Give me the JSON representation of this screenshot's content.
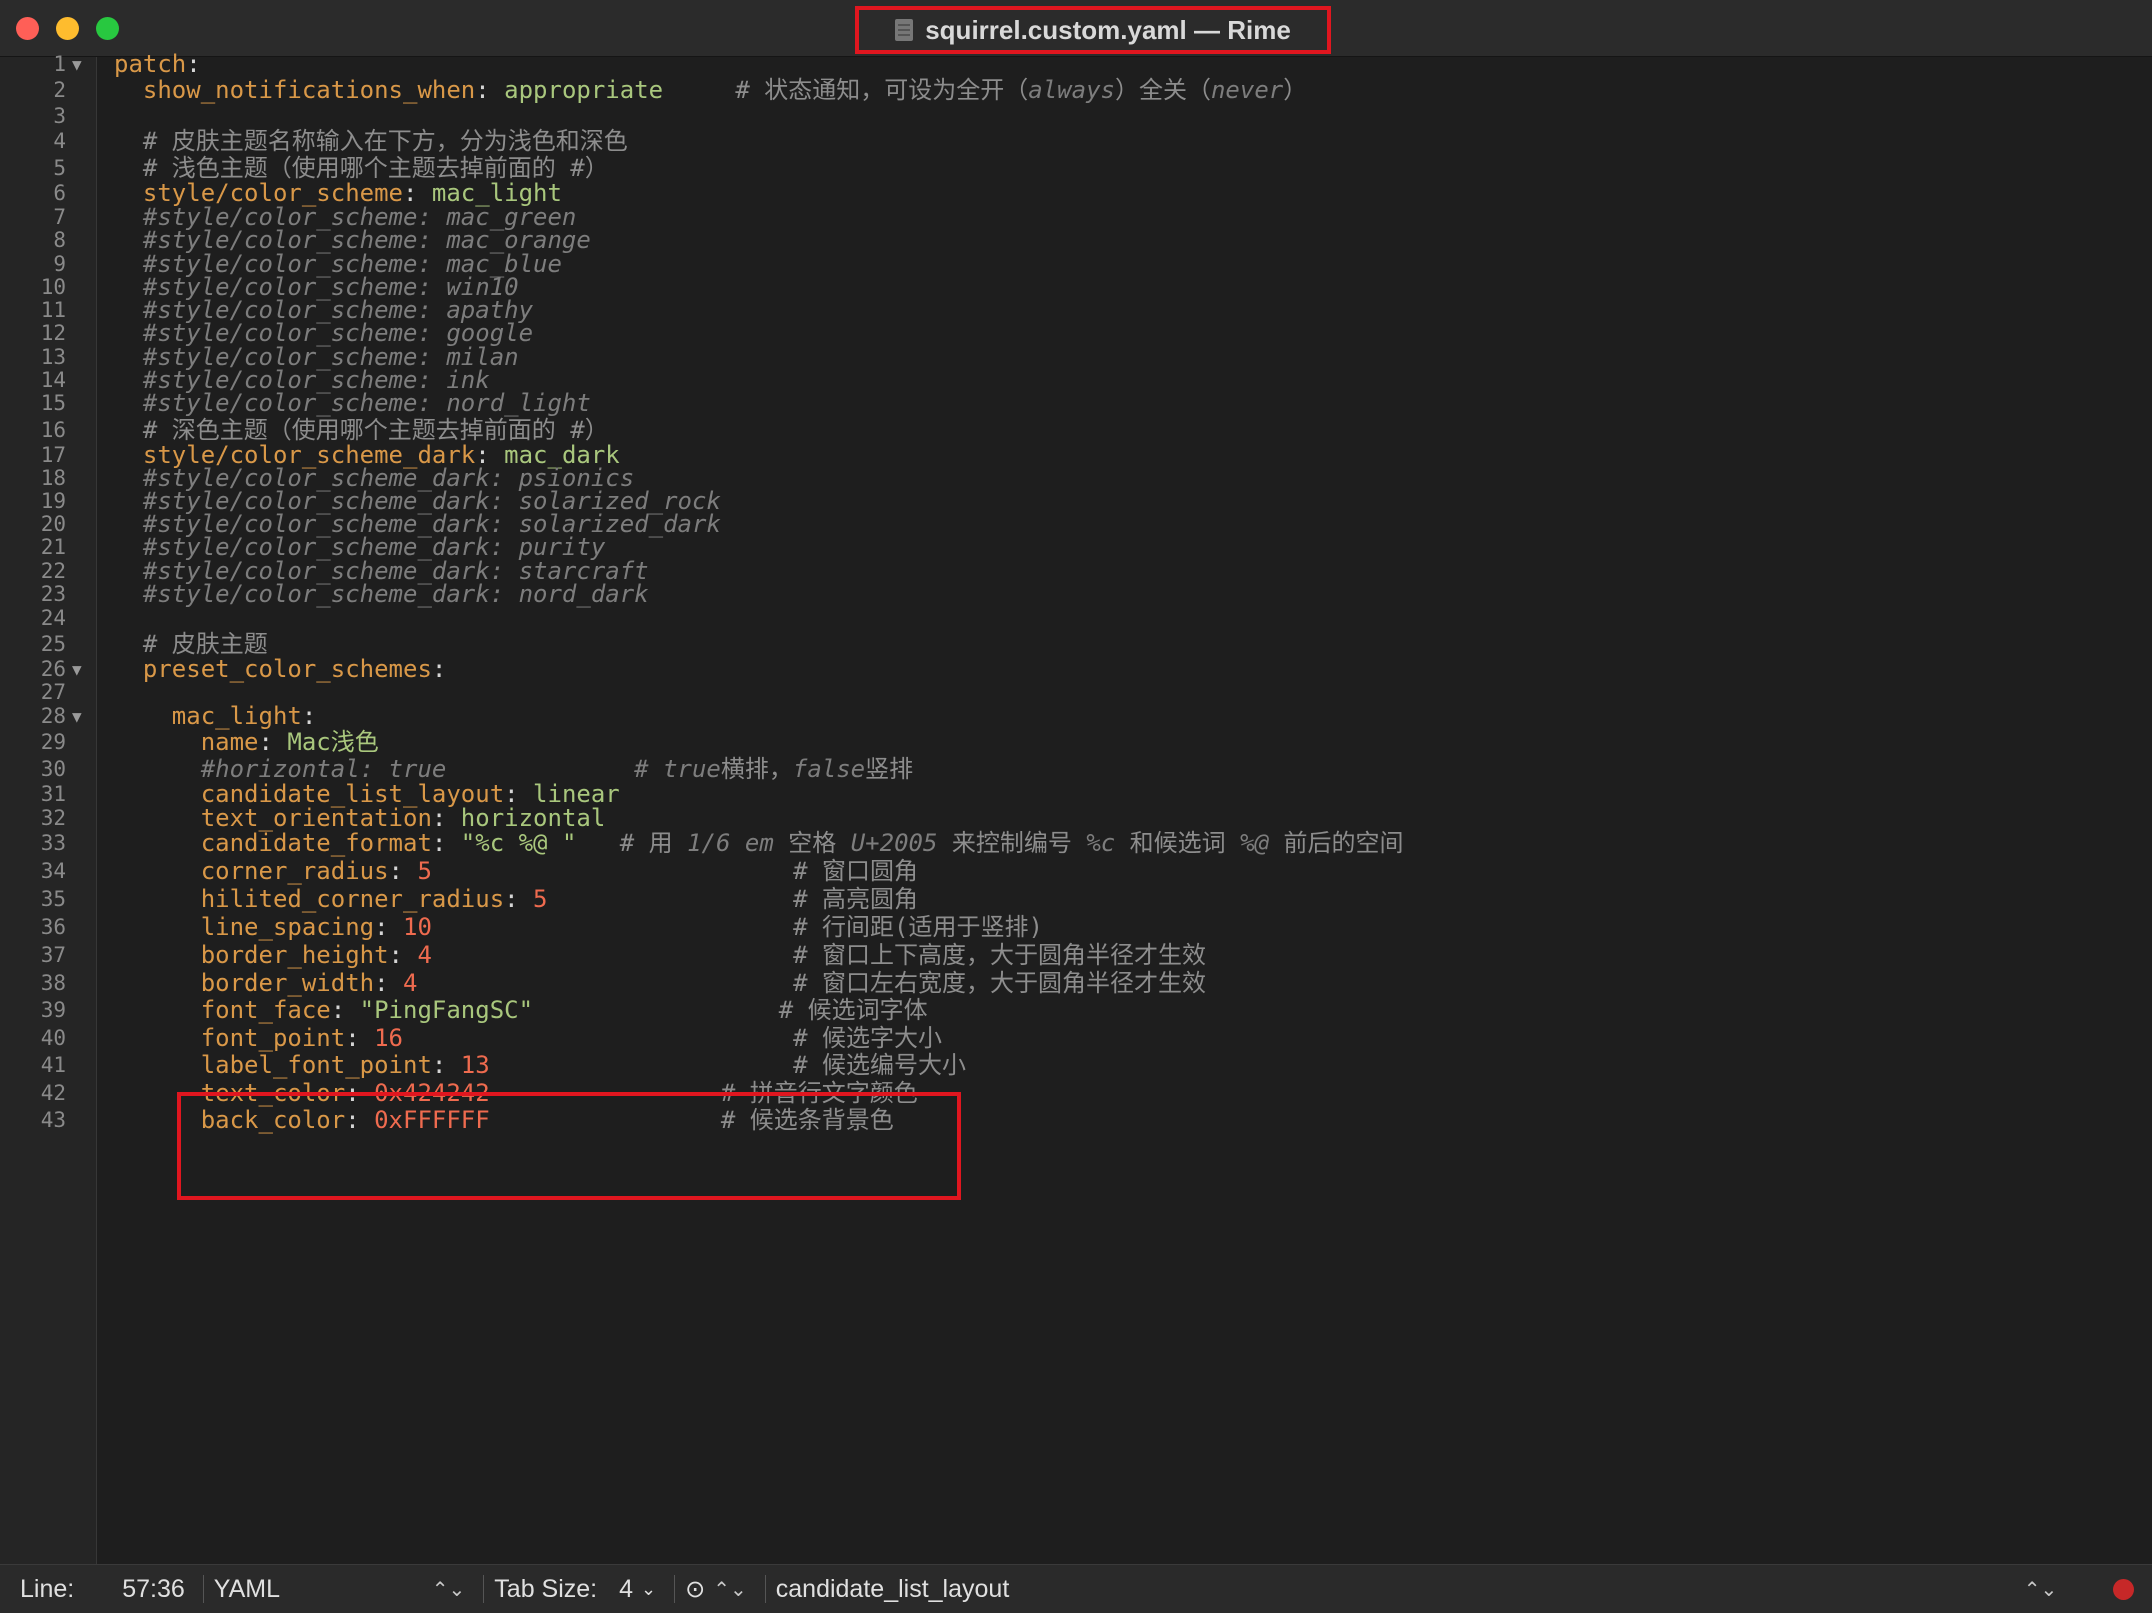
{
  "window": {
    "title": "squirrel.custom.yaml — Rime"
  },
  "statusbar": {
    "line_label": "Line:",
    "position": "57:36",
    "language": "YAML",
    "tab_label": "Tab Size:",
    "tab_size": "4",
    "symbol": "candidate_list_layout"
  },
  "code": [
    {
      "n": "1",
      "fold": true,
      "parts": [
        [
          "k",
          "patch"
        ],
        [
          "p",
          ":"
        ]
      ]
    },
    {
      "n": "2",
      "parts": [
        [
          "p",
          "  "
        ],
        [
          "k",
          "show_notifications_when"
        ],
        [
          "p",
          ": "
        ],
        [
          "v",
          "appropriate"
        ],
        [
          "p",
          "     "
        ],
        [
          "cmt",
          "# 状态通知，可设为全开（"
        ],
        [
          "c",
          "always"
        ],
        [
          "cmt",
          "）全关（"
        ],
        [
          "c",
          "never"
        ],
        [
          "cmt",
          "）"
        ]
      ]
    },
    {
      "n": "3",
      "parts": []
    },
    {
      "n": "4",
      "parts": [
        [
          "p",
          "  "
        ],
        [
          "cmt",
          "# 皮肤主题名称输入在下方，分为浅色和深色"
        ]
      ]
    },
    {
      "n": "5",
      "parts": [
        [
          "p",
          "  "
        ],
        [
          "cmt",
          "# 浅色主题（使用哪个主题去掉前面的 #）"
        ]
      ]
    },
    {
      "n": "6",
      "parts": [
        [
          "p",
          "  "
        ],
        [
          "k",
          "style/color_scheme"
        ],
        [
          "p",
          ": "
        ],
        [
          "v",
          "mac_light"
        ]
      ]
    },
    {
      "n": "7",
      "parts": [
        [
          "p",
          "  "
        ],
        [
          "c",
          "#style/color_scheme: mac_green"
        ]
      ]
    },
    {
      "n": "8",
      "parts": [
        [
          "p",
          "  "
        ],
        [
          "c",
          "#style/color_scheme: mac_orange"
        ]
      ]
    },
    {
      "n": "9",
      "parts": [
        [
          "p",
          "  "
        ],
        [
          "c",
          "#style/color_scheme: mac_blue"
        ]
      ]
    },
    {
      "n": "10",
      "parts": [
        [
          "p",
          "  "
        ],
        [
          "c",
          "#style/color_scheme: win10"
        ]
      ]
    },
    {
      "n": "11",
      "parts": [
        [
          "p",
          "  "
        ],
        [
          "c",
          "#style/color_scheme: apathy"
        ]
      ]
    },
    {
      "n": "12",
      "parts": [
        [
          "p",
          "  "
        ],
        [
          "c",
          "#style/color_scheme: google"
        ]
      ]
    },
    {
      "n": "13",
      "parts": [
        [
          "p",
          "  "
        ],
        [
          "c",
          "#style/color_scheme: milan"
        ]
      ]
    },
    {
      "n": "14",
      "parts": [
        [
          "p",
          "  "
        ],
        [
          "c",
          "#style/color_scheme: ink"
        ]
      ]
    },
    {
      "n": "15",
      "parts": [
        [
          "p",
          "  "
        ],
        [
          "c",
          "#style/color_scheme: nord_light"
        ]
      ]
    },
    {
      "n": "16",
      "parts": [
        [
          "p",
          "  "
        ],
        [
          "cmt",
          "# 深色主题（使用哪个主题去掉前面的 #）"
        ]
      ]
    },
    {
      "n": "17",
      "parts": [
        [
          "p",
          "  "
        ],
        [
          "k",
          "style/color_scheme_dark"
        ],
        [
          "p",
          ": "
        ],
        [
          "v",
          "mac_dark"
        ]
      ]
    },
    {
      "n": "18",
      "parts": [
        [
          "p",
          "  "
        ],
        [
          "c",
          "#style/color_scheme_dark: psionics"
        ]
      ]
    },
    {
      "n": "19",
      "parts": [
        [
          "p",
          "  "
        ],
        [
          "c",
          "#style/color_scheme_dark: solarized_rock"
        ]
      ]
    },
    {
      "n": "20",
      "parts": [
        [
          "p",
          "  "
        ],
        [
          "c",
          "#style/color_scheme_dark: solarized_dark"
        ]
      ]
    },
    {
      "n": "21",
      "parts": [
        [
          "p",
          "  "
        ],
        [
          "c",
          "#style/color_scheme_dark: purity"
        ]
      ]
    },
    {
      "n": "22",
      "parts": [
        [
          "p",
          "  "
        ],
        [
          "c",
          "#style/color_scheme_dark: starcraft"
        ]
      ]
    },
    {
      "n": "23",
      "parts": [
        [
          "p",
          "  "
        ],
        [
          "c",
          "#style/color_scheme_dark: nord_dark"
        ]
      ]
    },
    {
      "n": "24",
      "parts": []
    },
    {
      "n": "25",
      "parts": [
        [
          "p",
          "  "
        ],
        [
          "cmt",
          "# 皮肤主题"
        ]
      ]
    },
    {
      "n": "26",
      "fold": true,
      "parts": [
        [
          "p",
          "  "
        ],
        [
          "k",
          "preset_color_schemes"
        ],
        [
          "p",
          ":"
        ]
      ]
    },
    {
      "n": "27",
      "parts": []
    },
    {
      "n": "28",
      "fold": true,
      "parts": [
        [
          "p",
          "    "
        ],
        [
          "k",
          "mac_light"
        ],
        [
          "p",
          ":"
        ]
      ]
    },
    {
      "n": "29",
      "parts": [
        [
          "p",
          "      "
        ],
        [
          "k",
          "name"
        ],
        [
          "p",
          ": "
        ],
        [
          "v",
          "Mac浅色"
        ]
      ]
    },
    {
      "n": "30",
      "parts": [
        [
          "p",
          "      "
        ],
        [
          "c",
          "#horizontal: true             # true"
        ],
        [
          "cmt",
          "横排，"
        ],
        [
          "c",
          "false"
        ],
        [
          "cmt",
          "竖排"
        ]
      ]
    },
    {
      "n": "31",
      "parts": [
        [
          "p",
          "      "
        ],
        [
          "k",
          "candidate_list_layout"
        ],
        [
          "p",
          ": "
        ],
        [
          "v",
          "linear"
        ]
      ]
    },
    {
      "n": "32",
      "parts": [
        [
          "p",
          "      "
        ],
        [
          "k",
          "text_orientation"
        ],
        [
          "p",
          ": "
        ],
        [
          "v",
          "horizontal"
        ]
      ]
    },
    {
      "n": "33",
      "parts": [
        [
          "p",
          "      "
        ],
        [
          "k",
          "candidate_format"
        ],
        [
          "p",
          ": "
        ],
        [
          "v",
          "\"%c %@ \""
        ],
        [
          "p",
          "   "
        ],
        [
          "cmt",
          "# 用 "
        ],
        [
          "c",
          "1/6 em"
        ],
        [
          "cmt",
          " 空格 "
        ],
        [
          "c",
          "U+2005"
        ],
        [
          "cmt",
          " 来控制编号 "
        ],
        [
          "c",
          "%c"
        ],
        [
          "cmt",
          " 和候选词 "
        ],
        [
          "c",
          "%@"
        ],
        [
          "cmt",
          " 前后的空间"
        ]
      ]
    },
    {
      "n": "34",
      "parts": [
        [
          "p",
          "      "
        ],
        [
          "k",
          "corner_radius"
        ],
        [
          "p",
          ": "
        ],
        [
          "n",
          "5"
        ],
        [
          "p",
          "                         "
        ],
        [
          "cmt",
          "# 窗口圆角"
        ]
      ]
    },
    {
      "n": "35",
      "parts": [
        [
          "p",
          "      "
        ],
        [
          "k",
          "hilited_corner_radius"
        ],
        [
          "p",
          ": "
        ],
        [
          "n",
          "5"
        ],
        [
          "p",
          "                 "
        ],
        [
          "cmt",
          "# 高亮圆角"
        ]
      ]
    },
    {
      "n": "36",
      "parts": [
        [
          "p",
          "      "
        ],
        [
          "k",
          "line_spacing"
        ],
        [
          "p",
          ": "
        ],
        [
          "n",
          "10"
        ],
        [
          "p",
          "                         "
        ],
        [
          "cmt",
          "# 行间距(适用于竖排)"
        ]
      ]
    },
    {
      "n": "37",
      "parts": [
        [
          "p",
          "      "
        ],
        [
          "k",
          "border_height"
        ],
        [
          "p",
          ": "
        ],
        [
          "n",
          "4"
        ],
        [
          "p",
          "                         "
        ],
        [
          "cmt",
          "# 窗口上下高度，大于圆角半径才生效"
        ]
      ]
    },
    {
      "n": "38",
      "parts": [
        [
          "p",
          "      "
        ],
        [
          "k",
          "border_width"
        ],
        [
          "p",
          ": "
        ],
        [
          "n",
          "4"
        ],
        [
          "p",
          "                          "
        ],
        [
          "cmt",
          "# 窗口左右宽度，大于圆角半径才生效"
        ]
      ]
    },
    {
      "n": "39",
      "parts": [
        [
          "p",
          "      "
        ],
        [
          "k",
          "font_face"
        ],
        [
          "p",
          ": "
        ],
        [
          "v",
          "\"PingFangSC\""
        ],
        [
          "p",
          "                 "
        ],
        [
          "cmt",
          "# 候选词字体"
        ]
      ]
    },
    {
      "n": "40",
      "parts": [
        [
          "p",
          "      "
        ],
        [
          "k",
          "font_point"
        ],
        [
          "p",
          ": "
        ],
        [
          "n",
          "16"
        ],
        [
          "p",
          "                           "
        ],
        [
          "cmt",
          "# 候选字大小"
        ]
      ]
    },
    {
      "n": "41",
      "parts": [
        [
          "p",
          "      "
        ],
        [
          "k",
          "label_font_point"
        ],
        [
          "p",
          ": "
        ],
        [
          "n",
          "13"
        ],
        [
          "p",
          "                     "
        ],
        [
          "cmt",
          "# 候选编号大小"
        ]
      ]
    },
    {
      "n": "42",
      "parts": [
        [
          "p",
          "      "
        ],
        [
          "k",
          "text_color"
        ],
        [
          "p",
          ": "
        ],
        [
          "n",
          "0x424242"
        ],
        [
          "p",
          "                "
        ],
        [
          "cmt",
          "# 拼音行文字颜色"
        ]
      ]
    },
    {
      "n": "43",
      "parts": [
        [
          "p",
          "      "
        ],
        [
          "k",
          "back_color"
        ],
        [
          "p",
          ": "
        ],
        [
          "n",
          "0xFFFFFF"
        ],
        [
          "p",
          "                "
        ],
        [
          "cmt",
          "# 候选条背景色"
        ]
      ]
    }
  ]
}
